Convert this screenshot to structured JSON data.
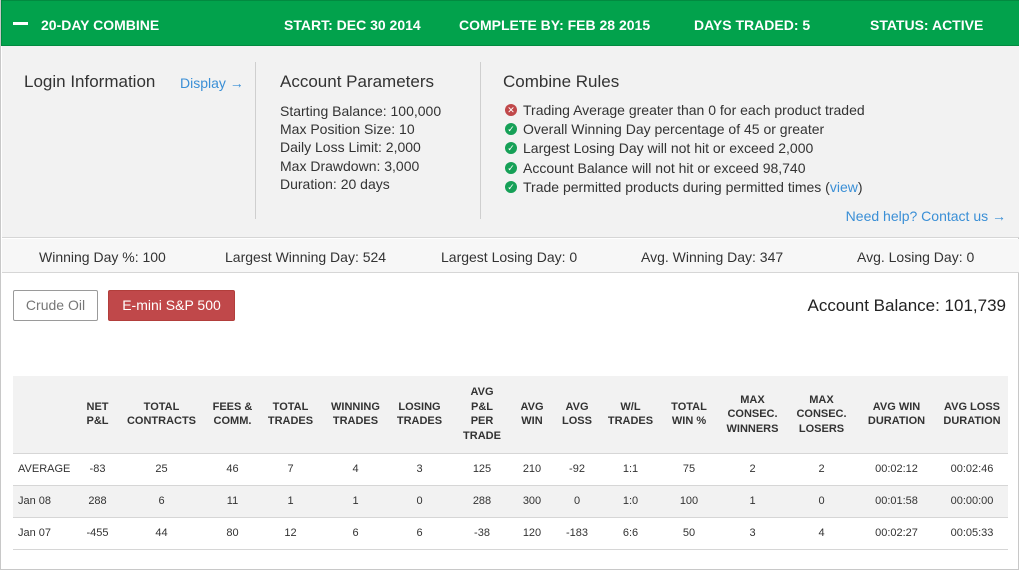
{
  "header": {
    "title": "20-DAY COMBINE",
    "start": "START: DEC 30 2014",
    "complete_by": "COMPLETE BY: FEB 28 2015",
    "days_traded": "DAYS TRADED: 5",
    "status": "STATUS: ACTIVE"
  },
  "colors": {
    "header_bg": "#02a24c",
    "active_product": "#c0484a",
    "link": "#3a8fd6",
    "rule_pass": "#16a057",
    "rule_fail": "#c0484a"
  },
  "login": {
    "title": "Login Information",
    "display_link": "Display →"
  },
  "params": {
    "title": "Account Parameters",
    "items": [
      "Starting Balance: 100,000",
      "Max Position Size: 10",
      "Daily Loss Limit: 2,000",
      "Max Drawdown: 3,000",
      "Duration: 20 days"
    ]
  },
  "rules": {
    "title": "Combine Rules",
    "items": [
      {
        "text": "Trading Average greater than 0 for each product traded",
        "status": "fail",
        "icon": "x-circle-icon"
      },
      {
        "text": "Overall Winning Day percentage of 45 or greater",
        "status": "pass",
        "icon": "check-circle-icon"
      },
      {
        "text": "Largest Losing Day will not hit or exceed 2,000",
        "status": "pass",
        "icon": "check-circle-icon"
      },
      {
        "text": "Account Balance will not hit or exceed 98,740",
        "status": "pass",
        "icon": "check-circle-icon"
      },
      {
        "text": "Trade permitted products during permitted times (",
        "status": "pass",
        "icon": "check-circle-icon"
      }
    ],
    "view_link": "view",
    "close_paren": ")",
    "help_link": "Need help? Contact us →"
  },
  "stats": {
    "winning_pct": "Winning Day %: 100",
    "largest_win": "Largest Winning Day: 524",
    "largest_loss": "Largest Losing Day: 0",
    "avg_win": "Avg. Winning Day: 347",
    "avg_loss": "Avg. Losing Day: 0"
  },
  "products": {
    "crude": "Crude Oil",
    "emini": "E-mini S&P 500",
    "selected": "E-mini S&P 500"
  },
  "account_balance": "Account Balance: 101,739",
  "table": {
    "headers": [
      [
        "NET",
        "P&L"
      ],
      [
        "TOTAL",
        "CONTRACTS"
      ],
      [
        "FEES &",
        "COMM."
      ],
      [
        "TOTAL",
        "TRADES"
      ],
      [
        "WINNING",
        "TRADES"
      ],
      [
        "LOSING",
        "TRADES"
      ],
      [
        "AVG",
        "P&L",
        "PER",
        "TRADE"
      ],
      [
        "AVG",
        "WIN"
      ],
      [
        "AVG",
        "LOSS"
      ],
      [
        "W/L",
        "TRADES"
      ],
      [
        "TOTAL",
        "WIN %"
      ],
      [
        "MAX",
        "CONSEC.",
        "WINNERS"
      ],
      [
        "MAX",
        "CONSEC.",
        "LOSERS"
      ],
      [
        "AVG WIN",
        "DURATION"
      ],
      [
        "AVG LOSS",
        "DURATION"
      ]
    ],
    "rows": [
      {
        "label": "AVERAGE",
        "cells": [
          "-83",
          "25",
          "46",
          "7",
          "4",
          "3",
          "125",
          "210",
          "-92",
          "1:1",
          "75",
          "2",
          "2",
          "00:02:12",
          "00:02:46"
        ]
      },
      {
        "label": "Jan 08",
        "cells": [
          "288",
          "6",
          "11",
          "1",
          "1",
          "0",
          "288",
          "300",
          "0",
          "1:0",
          "100",
          "1",
          "0",
          "00:01:58",
          "00:00:00"
        ]
      },
      {
        "label": "Jan 07",
        "cells": [
          "-455",
          "44",
          "80",
          "12",
          "6",
          "6",
          "-38",
          "120",
          "-183",
          "6:6",
          "50",
          "3",
          "4",
          "00:02:27",
          "00:05:33"
        ]
      }
    ]
  }
}
